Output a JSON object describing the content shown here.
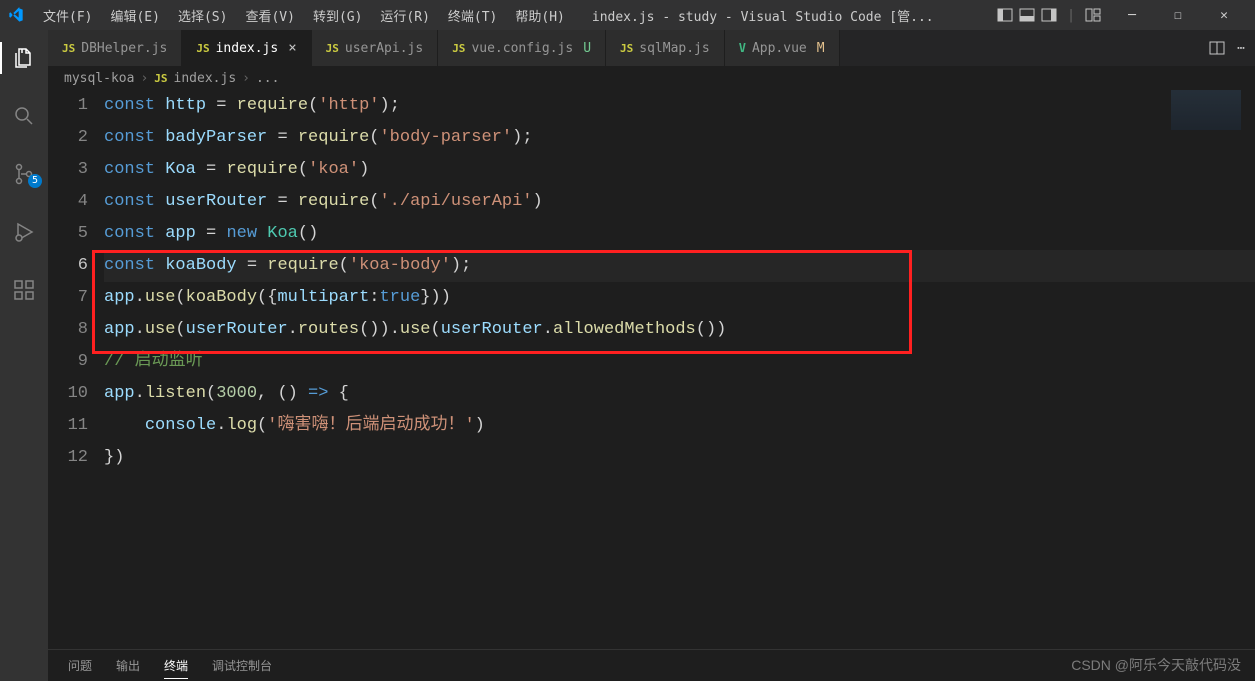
{
  "menu": {
    "file": "文件(F)",
    "edit": "编辑(E)",
    "selection": "选择(S)",
    "view": "查看(V)",
    "go": "转到(G)",
    "run": "运行(R)",
    "terminal": "终端(T)",
    "help": "帮助(H)"
  },
  "window_title": "index.js - study - Visual Studio Code [管...",
  "activity": {
    "scm_badge": "5"
  },
  "tabs": {
    "t0": {
      "label": "DBHelper.js"
    },
    "t1": {
      "label": "index.js"
    },
    "t2": {
      "label": "userApi.js"
    },
    "t3": {
      "label": "vue.config.js",
      "status": "U"
    },
    "t4": {
      "label": "sqlMap.js"
    },
    "t5": {
      "label": "App.vue",
      "status": "M"
    }
  },
  "breadcrumbs": {
    "root": "mysql-koa",
    "file": "index.js",
    "trail": "..."
  },
  "lines": {
    "l1": "1",
    "l2": "2",
    "l3": "3",
    "l4": "4",
    "l5": "5",
    "l6": "6",
    "l7": "7",
    "l8": "8",
    "l9": "9",
    "l10": "10",
    "l11": "11",
    "l12": "12"
  },
  "code": {
    "c_const": "const",
    "c_new": "new",
    "c_http": "http",
    "c_require": "require",
    "c_http_str": "'http'",
    "c_badyParser": "badyParser",
    "c_bp_str": "'body-parser'",
    "c_Koa": "Koa",
    "c_koa_str": "'koa'",
    "c_userRouter": "userRouter",
    "c_ur_str": "'./api/userApi'",
    "c_app": "app",
    "c_koaBody": "koaBody",
    "c_kb_str": "'koa-body'",
    "c_use": "use",
    "c_multipart": "multipart",
    "c_true": "true",
    "c_routes": "routes",
    "c_allowed": "allowedMethods",
    "c_cmt": "// 启动监听",
    "c_listen": "listen",
    "c_3000": "3000",
    "c_console": "console",
    "c_log": "log",
    "c_log_str": "'嗨害嗨！后端启动成功！'",
    "c_eq": " = ",
    "c_semi": ";",
    "c_lp": "(",
    "c_rp": ")",
    "c_dot": ".",
    "c_lc": "{",
    "c_rc": "}",
    "c_col": ":",
    "c_comma": ", ",
    "c_arrow": " => "
  },
  "panel": {
    "problems": "问题",
    "output": "输出",
    "terminal": "终端",
    "debug": "调试控制台"
  },
  "watermark": "CSDN @阿乐今天敲代码没"
}
